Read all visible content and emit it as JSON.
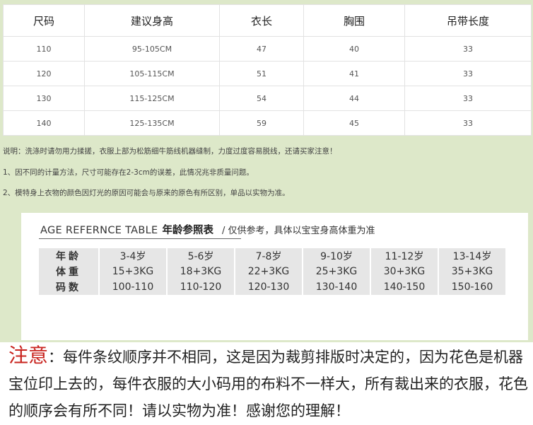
{
  "size_table": {
    "headers": [
      "尺码",
      "建议身高",
      "衣长",
      "胸围",
      "吊带长度"
    ],
    "rows": [
      [
        "110",
        "95-105CM",
        "47",
        "40",
        "33"
      ],
      [
        "120",
        "105-115CM",
        "51",
        "41",
        "33"
      ],
      [
        "130",
        "115-125CM",
        "54",
        "44",
        "33"
      ],
      [
        "140",
        "125-135CM",
        "59",
        "45",
        "33"
      ]
    ]
  },
  "notes": [
    "说明：洗涤时请勿用力揉搓，衣服上部为松筋细牛筋线机器缝制，力度过度容易脱线，还请买家注意！",
    "1、因不同的计量方法，尺寸可能存在2-3cm的误差，此情况兆非质量问题。",
    "2、模特身上衣物的颜色因灯光的原因可能会与原来的原色有所区别，单品以实物为准。"
  ],
  "age_reference": {
    "title_en": "AGE REFERNCE TABLE",
    "title_cn": "年龄参照表",
    "subtitle": "/ 仅供参考，具体以宝宝身高体重为准",
    "rows": [
      {
        "label": "年龄",
        "values": [
          "3-4岁",
          "5-6岁",
          "7-8岁",
          "9-10岁",
          "11-12岁",
          "13-14岁"
        ]
      },
      {
        "label": "体重",
        "values": [
          "15+3KG",
          "18+3KG",
          "22+3KG",
          "25+3KG",
          "30+3KG",
          "35+3KG"
        ]
      },
      {
        "label": "码数",
        "values": [
          "100-110",
          "110-120",
          "120-130",
          "130-140",
          "140-150",
          "150-160"
        ]
      }
    ]
  },
  "notice": {
    "tag": "注意",
    "text": "：每件条纹顺序并不相同，这是因为裁剪排版时决定的，因为花色是机器宝位印上去的，每件衣服的大小码用的布料不一样大，所有裁出来的衣服，花色的顺序会有所不同！请以实物为准！感谢您的理解！"
  },
  "colors": {
    "panel_bg": "#dde8c9",
    "notice_tag": "#c8231e",
    "age_cell_bg": "#e6e6e6"
  }
}
